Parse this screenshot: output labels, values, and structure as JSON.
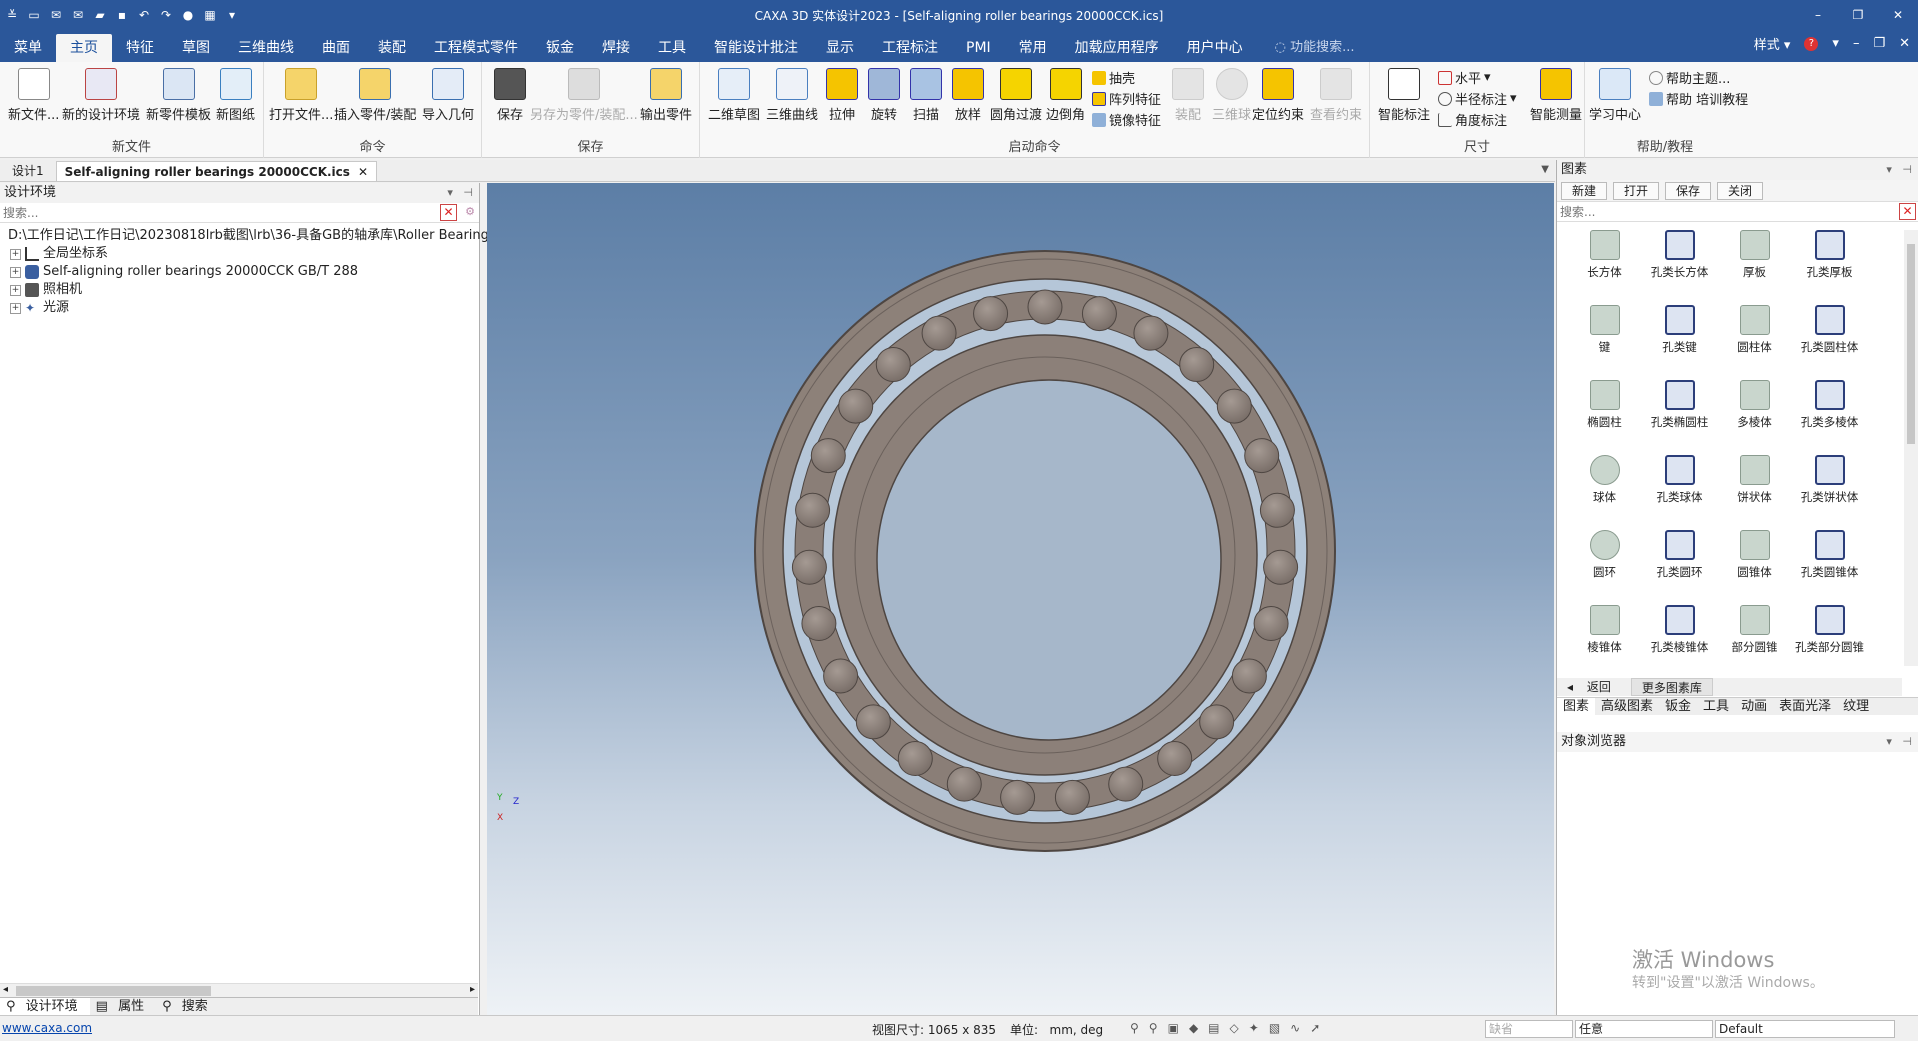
{
  "titlebar": {
    "title": "CAXA 3D 实体设计2023 - [Self-aligning roller bearings 20000CCK.ics]",
    "minimize": "–",
    "restore": "❐",
    "close": "✕"
  },
  "menubar": {
    "items": [
      "菜单",
      "主页",
      "特征",
      "草图",
      "三维曲线",
      "曲面",
      "装配",
      "工程模式零件",
      "钣金",
      "焊接",
      "工具",
      "智能设计批注",
      "显示",
      "工程标注",
      "PMI",
      "常用",
      "加载应用程序",
      "用户中心"
    ],
    "active": "主页",
    "search_placeholder": "功能搜索...",
    "style_label": "样式",
    "help_icon": "?"
  },
  "ribbon": {
    "groups": {
      "new_file": "新文件",
      "command": "命令",
      "save": "保存",
      "launch": "启动命令",
      "dimension": "尺寸",
      "help": "帮助/教程"
    },
    "buttons": {
      "new_file": "新文件...",
      "new_design_env": "新的设计环境",
      "new_part_template": "新零件模板",
      "new_drawing": "新图纸",
      "open_file": "打开文件...",
      "insert_part": "插入零件/装配",
      "import_geometry": "导入几何",
      "save": "保存",
      "save_as_part": "另存为零件/装配...",
      "export_part": "输出零件",
      "sketch_2d": "二维草图",
      "curve_3d": "三维曲线",
      "extrude": "拉伸",
      "revolve": "旋转",
      "sweep": "扫描",
      "loft": "放样",
      "fillet": "圆角过渡",
      "chamfer": "边倒角",
      "shell": "抽壳",
      "array": "阵列特征",
      "mirror": "镜像特征",
      "assemble": "装配",
      "sphere3": "三维球",
      "position_constraint": "定位约束",
      "view_constraint": "查看约束",
      "smart_dim": "智能标注",
      "horizontal": "水平",
      "radius_dim": "半径标注",
      "angle_dim": "角度标注",
      "smart_measure": "智能测量",
      "learning_center": "学习中心",
      "help_topics": "帮助主题...",
      "training": "帮助 培训教程"
    }
  },
  "doctabs": {
    "tab1": "设计1",
    "tab2": "Self-aligning roller bearings 20000CCK.ics",
    "close": "✕"
  },
  "leftpanel": {
    "title": "设计环境",
    "search_placeholder": "搜索...",
    "tree": [
      "D:\\工作日记\\工作日记\\20230818lrb截图\\lrb\\36-具备GB的轴承库\\Roller Bearings\\",
      "全局坐标系",
      "Self-aligning roller bearings 20000CCK GB/T 288",
      "照相机",
      "光源"
    ],
    "tabs": [
      "设计环境",
      "属性",
      "搜索"
    ]
  },
  "rightpanel": {
    "title": "图素",
    "toolbar": [
      "新建",
      "打开",
      "保存",
      "关闭"
    ],
    "search_placeholder": "搜索...",
    "shapes": [
      "长方体",
      "孔类长方体",
      "厚板",
      "孔类厚板",
      "键",
      "孔类键",
      "圆柱体",
      "孔类圆柱体",
      "椭圆柱",
      "孔类椭圆柱",
      "多棱体",
      "孔类多棱体",
      "球体",
      "孔类球体",
      "饼状体",
      "孔类饼状体",
      "圆环",
      "孔类圆环",
      "圆锥体",
      "孔类圆锥体",
      "棱锥体",
      "孔类棱锥体",
      "部分圆锥",
      "孔类部分圆锥"
    ],
    "nav_back": "返回",
    "nav_more": "更多图素库",
    "categories": [
      "图素",
      "高级图素",
      "钣金",
      "工具",
      "动画",
      "表面光泽",
      "纹理"
    ],
    "object_browser": "对象浏览器",
    "watermark_line1": "激活 Windows",
    "watermark_line2": "转到\"设置\"以激活 Windows。"
  },
  "statusbar": {
    "link": "www.caxa.com",
    "view_size": "视图尺寸: 1065 x  835",
    "unit_label": "单位:",
    "unit_value": "mm, deg",
    "filter_dropdown": "缺省",
    "select_dropdown": "任意",
    "style_dropdown": "Default"
  },
  "colors": {
    "titlebar": "#2b579a",
    "bearing": "#8c8079",
    "bearing_dark": "#6f6560"
  }
}
